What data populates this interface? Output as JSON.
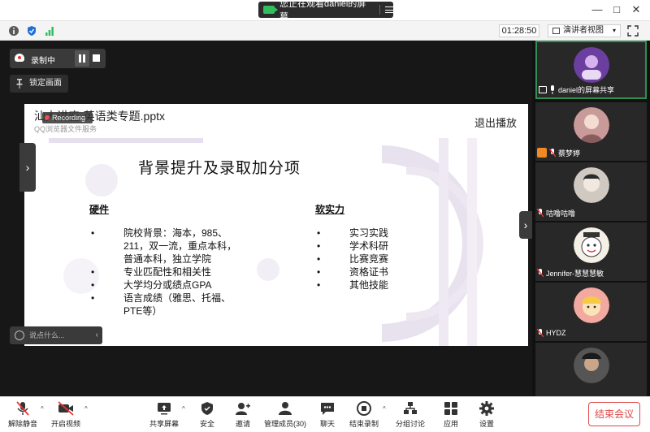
{
  "titlebar": {
    "share_status": "您正在观看daniel的屏幕"
  },
  "infobar": {
    "timer": "01:28:50",
    "view_mode": "演讲者视图"
  },
  "recording": {
    "label": "录制中",
    "lock_label": "锁定画面"
  },
  "ppt": {
    "title": "汕大讲座-英语类专题.pptx",
    "subtitle": "QQ浏览器文件服务",
    "recording_badge": "Recording",
    "exit_label": "退出播放"
  },
  "slide": {
    "title": "背景提升及录取加分项",
    "hard_heading": "硬件",
    "soft_heading": "软实力",
    "hard_items": [
      "院校背景：海本，985、",
      "211，双一流，重点本科，",
      "普通本科，独立学院",
      "专业匹配性和相关性",
      "大学均分或绩点GPA",
      "语言成绩（雅思、托福、",
      "PTE等）"
    ],
    "soft_items": [
      "实习实践",
      "学术科研",
      "比赛竞赛",
      "资格证书",
      "其他技能"
    ]
  },
  "chat": {
    "placeholder": "说点什么..."
  },
  "participants": [
    {
      "name": "daniel的屏幕共享",
      "color": "#6b3fa0"
    },
    {
      "name": "蔡梦婷",
      "color": "#c99a9a"
    },
    {
      "name": "咕噜咕噜",
      "color": "#cfc9c2"
    },
    {
      "name": "Jennifer-慧慧慧敏",
      "color": "#f5f0e6"
    },
    {
      "name": "HYDZ",
      "color": "#f2a9a0"
    },
    {
      "name": "",
      "color": "#555555"
    }
  ],
  "toolbar": {
    "unmute": "解除静音",
    "video": "开启视频",
    "share": "共享屏幕",
    "security": "安全",
    "invite": "邀请",
    "members": "管理成员(30)",
    "chat": "聊天",
    "end_record": "结束录制",
    "breakout": "分组讨论",
    "apps": "应用",
    "settings": "设置",
    "end_meeting": "结束会议"
  },
  "colors": {
    "accent_green": "#2fbf5c",
    "end_red": "#e04848",
    "host_orange": "#f08a24"
  }
}
